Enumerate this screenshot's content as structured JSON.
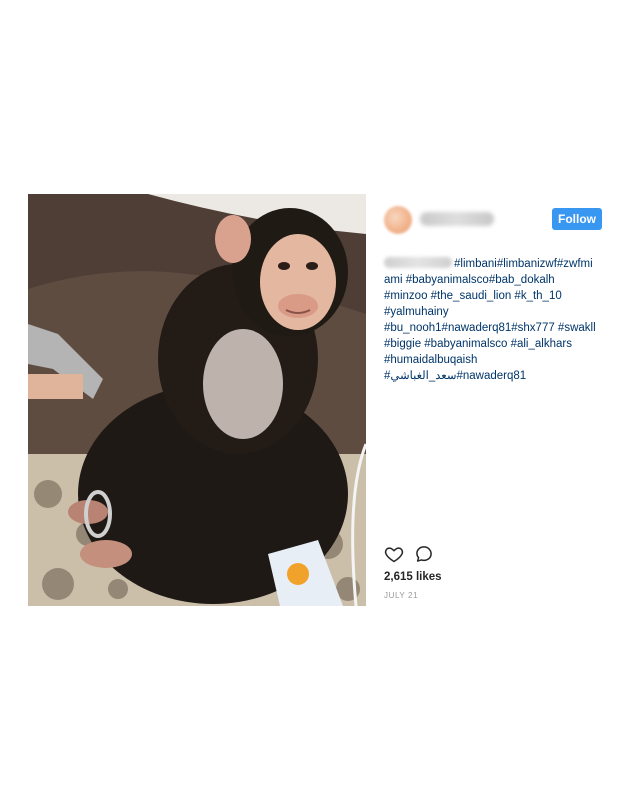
{
  "post": {
    "follow_label": "Follow",
    "caption_lines": [
      "#limbani#limbanizwf#zwfmi",
      "ami #babyanimalsco#bab_dokalh",
      "#minzoo #the_saudi_lion #k_th_10",
      "#yalmuhainy",
      "#bu_nooh1#nawaderq81#shx777 #swakll",
      "#biggie #babyanimalsco #ali_alkhars",
      "#humaidalbuqaish",
      "#سعد_الغباشي#nawaderq81"
    ],
    "likes": "2,615 likes",
    "date": "JULY 21"
  },
  "icons": {
    "like": "heart-outline-icon",
    "comment": "comment-bubble-icon"
  },
  "colors": {
    "follow_bg": "#3897f0",
    "hashtag": "#003569",
    "meta": "#999999"
  }
}
